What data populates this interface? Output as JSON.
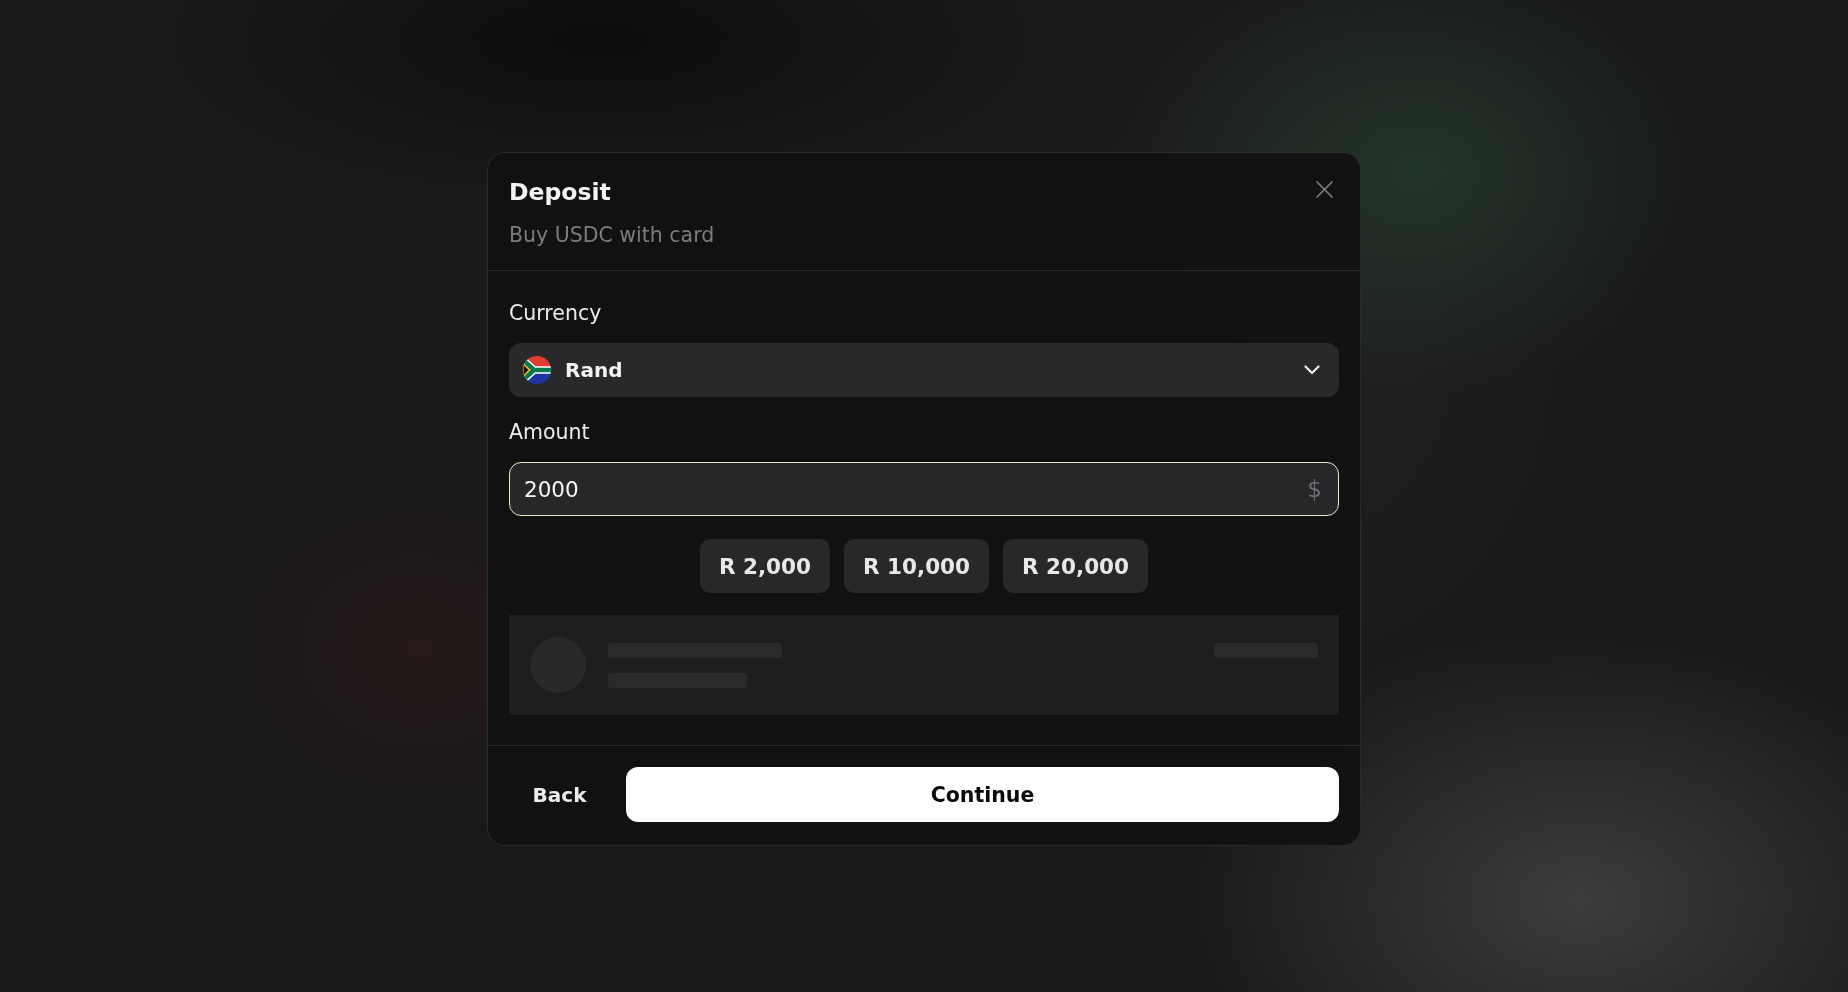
{
  "dialog": {
    "title": "Deposit",
    "subtitle": "Buy USDC with card"
  },
  "currency": {
    "label": "Currency",
    "value": "Rand"
  },
  "amount": {
    "label": "Amount",
    "value": "2000",
    "suffix": "$",
    "focused": true
  },
  "presets": [
    "R 2,000",
    "R 10,000",
    "R 20,000"
  ],
  "quote": {
    "loading": true
  },
  "footer": {
    "back": "Back",
    "continue": "Continue"
  }
}
